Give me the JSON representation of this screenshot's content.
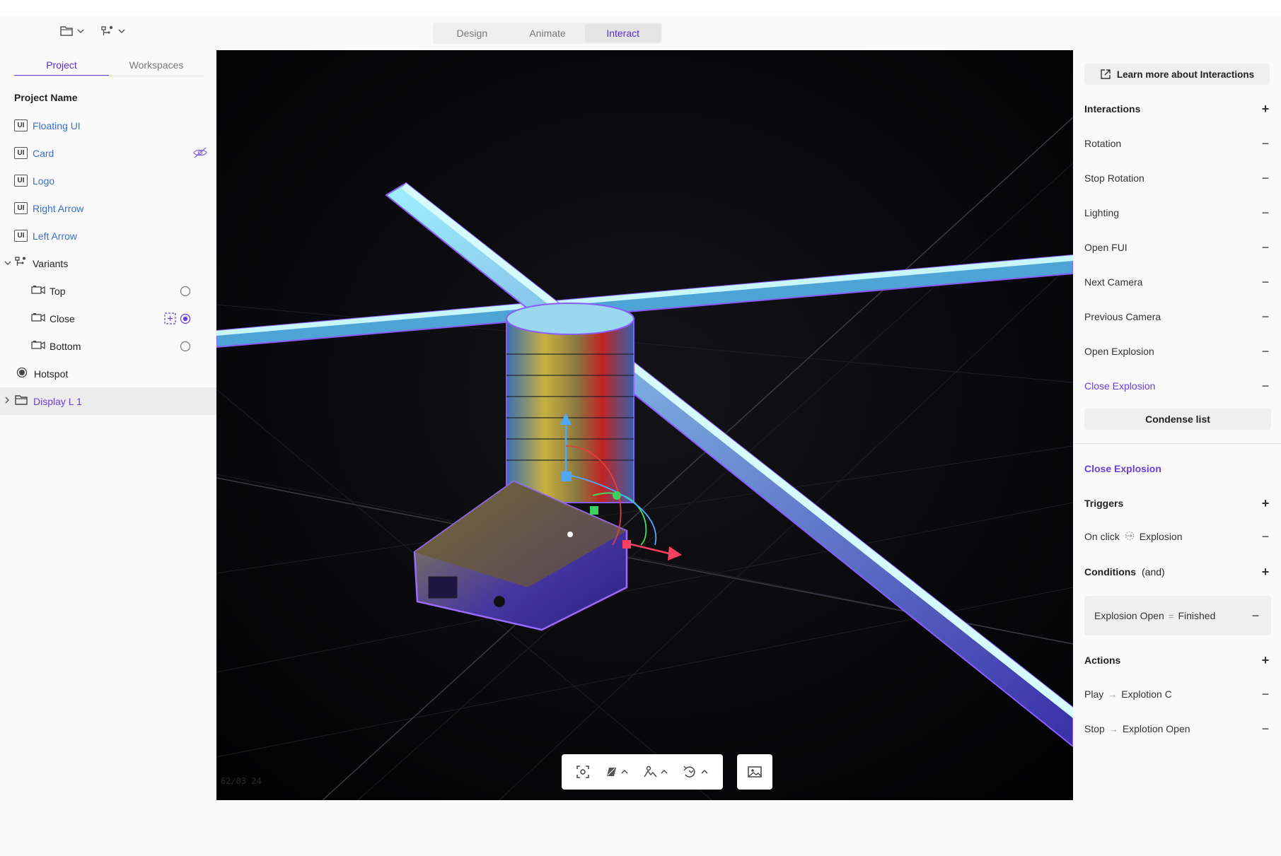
{
  "window": {
    "mode_tabs": [
      {
        "label": "Design",
        "active": false
      },
      {
        "label": "Animate",
        "active": false
      },
      {
        "label": "Interact",
        "active": true
      }
    ]
  },
  "toolbar_icons": [
    "folder-icon",
    "variants-icon"
  ],
  "left_panel": {
    "tabs": [
      {
        "label": "Project",
        "active": true
      },
      {
        "label": "Workspaces",
        "active": false
      }
    ],
    "project_name": "Project Name",
    "tree": [
      {
        "label": "Floating UI",
        "badge": "UI",
        "kind": "ui"
      },
      {
        "label": "Card",
        "badge": "UI",
        "kind": "ui",
        "hidden": true
      },
      {
        "label": "Logo",
        "badge": "UI",
        "kind": "ui"
      },
      {
        "label": "Right Arrow",
        "badge": "UI",
        "kind": "ui"
      },
      {
        "label": "Left Arrow",
        "badge": "UI",
        "kind": "ui"
      },
      {
        "label": "Variants",
        "kind": "variants"
      },
      {
        "label": "Top",
        "kind": "camera"
      },
      {
        "label": "Close",
        "kind": "camera",
        "selected": true
      },
      {
        "label": "Bottom",
        "kind": "camera"
      },
      {
        "label": "Hotspot",
        "kind": "hotspot"
      },
      {
        "label": "Display L 1",
        "kind": "folder",
        "highlighted": true
      }
    ]
  },
  "right_panel": {
    "learn_button": "Learn more about Interactions",
    "interactions_header": "Interactions",
    "interactions": [
      "Rotation",
      "Stop Rotation",
      "Lighting",
      "Open FUI",
      "Next Camera",
      "Previous Camera",
      "Open Explosion",
      "Close Explosion"
    ],
    "active_interaction": "Close Explosion",
    "condense_button": "Condense list",
    "detail_title": "Close Explosion",
    "triggers_header": "Triggers",
    "trigger": {
      "event": "On click",
      "target": "Explosion"
    },
    "conditions_header": "Conditions",
    "conditions_qualifier": "(and)",
    "condition": {
      "left": "Explosion Open",
      "op": "=",
      "right": "Finished"
    },
    "actions_header": "Actions",
    "actions": [
      {
        "verb": "Play",
        "target": "Explotion C"
      },
      {
        "verb": "Stop",
        "target": "Explotion Open"
      }
    ]
  },
  "viewport": {
    "stats": "62/03  24"
  },
  "colors": {
    "accent": "#6b3ee0",
    "link_blue": "#3a6fd8",
    "viewport_bg": "#050507"
  }
}
